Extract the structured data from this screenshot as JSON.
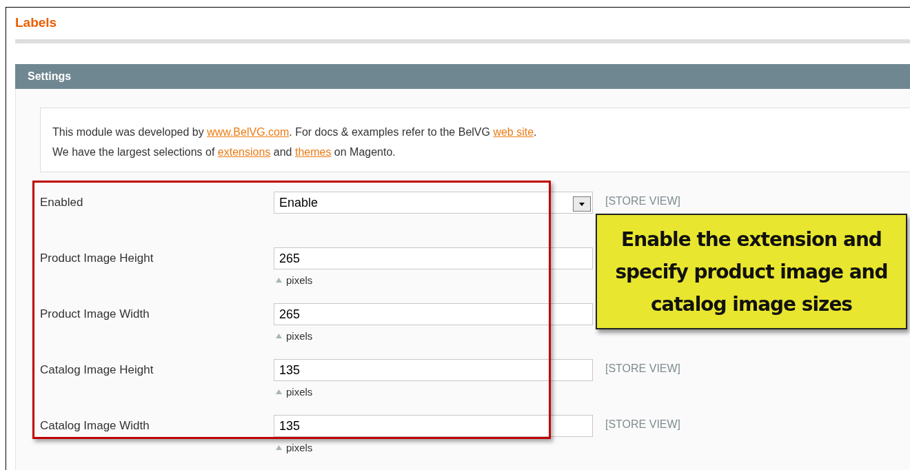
{
  "page_title": "Labels",
  "section": {
    "title": "Settings"
  },
  "intro": {
    "lines": [
      [
        {
          "kind": "text",
          "text": "This module was developed by "
        },
        {
          "kind": "link",
          "text": "www.BelVG.com"
        },
        {
          "kind": "text",
          "text": ". For docs & examples refer to the BelVG "
        },
        {
          "kind": "link",
          "text": "web site"
        },
        {
          "kind": "text",
          "text": "."
        }
      ],
      [
        {
          "kind": "text",
          "text": "We have the largest selections of "
        },
        {
          "kind": "link",
          "text": "extensions"
        },
        {
          "kind": "text",
          "text": " and "
        },
        {
          "kind": "link",
          "text": "themes"
        },
        {
          "kind": "text",
          "text": " on Magento."
        }
      ]
    ]
  },
  "fields": [
    {
      "kind": "select",
      "label": "Enabled",
      "value": "Enable",
      "scope": "[STORE VIEW]"
    },
    {
      "kind": "text",
      "label": "Product Image Height",
      "value": "265",
      "note": "pixels"
    },
    {
      "kind": "text",
      "label": "Product Image Width",
      "value": "265",
      "note": "pixels"
    },
    {
      "kind": "text",
      "label": "Catalog Image Height",
      "value": "135",
      "note": "pixels",
      "scope": "[STORE VIEW]"
    },
    {
      "kind": "text",
      "label": "Catalog Image Width",
      "value": "135",
      "note": "pixels",
      "scope": "[STORE VIEW]"
    }
  ],
  "callout": {
    "text": "Enable the extension and specify product image and catalog image sizes"
  }
}
